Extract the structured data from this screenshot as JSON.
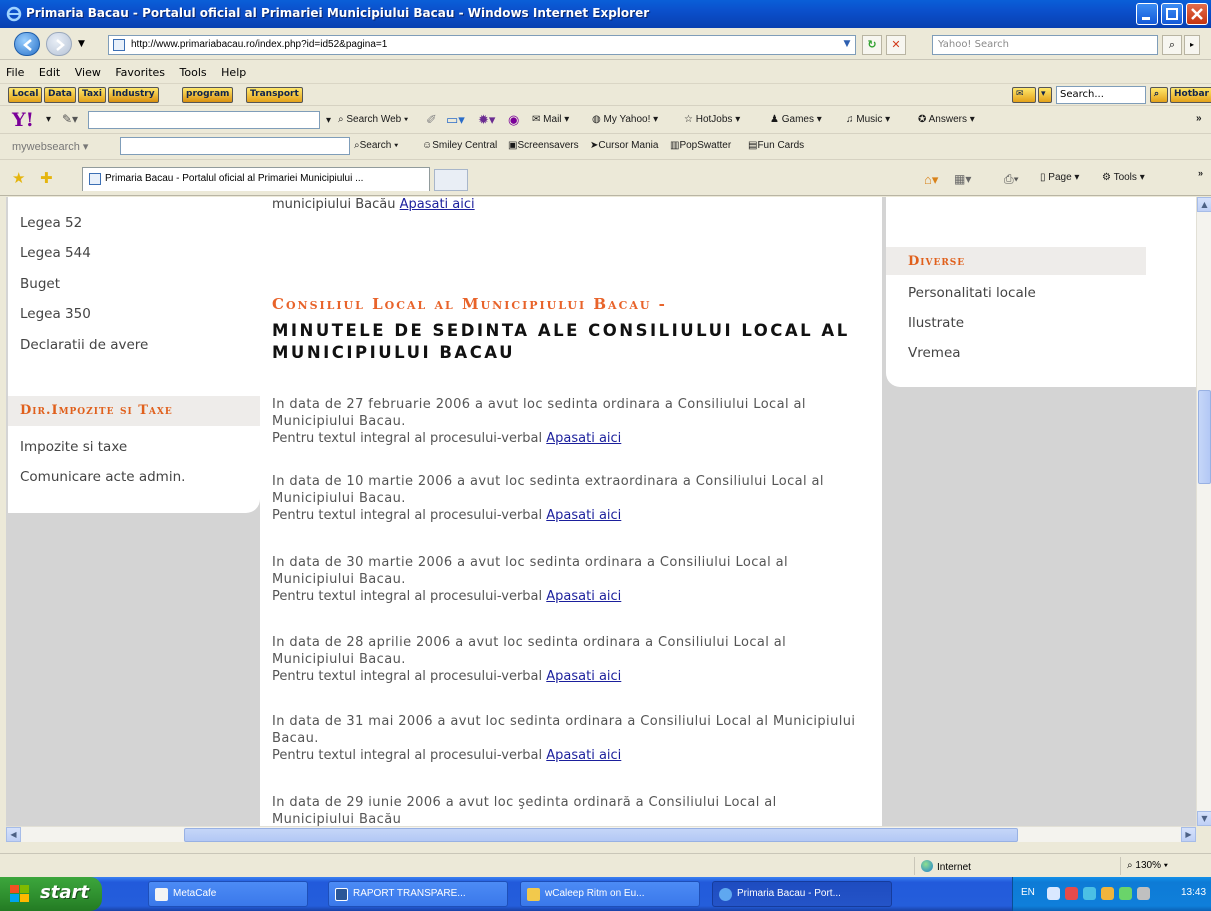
{
  "window": {
    "title": "Primaria Bacau - Portalul oficial al Primariei Municipiului Bacau - Windows Internet Explorer"
  },
  "address_bar": {
    "url": "http://www.primariabacau.ro/index.php?id=id52&pagina=1",
    "search_placeholder": "Yahoo! Search"
  },
  "menu": [
    "File",
    "Edit",
    "View",
    "Favorites",
    "Tools",
    "Help"
  ],
  "toolbar1": {
    "chips": [
      "Local",
      "Data",
      "Taxi",
      "Industry",
      "program",
      "Transport"
    ],
    "search_value": "Search...",
    "hotbar": "Hotbar"
  },
  "toolbar2": {
    "search_web": "Search Web",
    "items": [
      "Mail",
      "My Yahoo!",
      "HotJobs",
      "Games",
      "Music",
      "Answers"
    ]
  },
  "toolbar3": {
    "brand": "mywebsearch",
    "search": "Search",
    "items": [
      "Smiley Central",
      "Screensavers",
      "Cursor Mania",
      "PopSwatter",
      "Fun Cards"
    ]
  },
  "tab": {
    "label": "Primaria Bacau - Portalul oficial al Primariei Municipiului ..."
  },
  "cmdbar": {
    "page": "Page",
    "tools": "Tools"
  },
  "left_nav": {
    "items_top": [
      "Legea 52",
      "Legea 544",
      "Buget",
      "Legea 350",
      "Declaratii de avere"
    ],
    "section": "Dir.Impozite si Taxe",
    "items_bottom": [
      "Impozite si taxe",
      "Comunicare acte admin."
    ]
  },
  "main": {
    "top_text": "municipiului Bacău",
    "top_link": "Apasati aici",
    "heading1": "Consiliul Local al Municipiului Bacau -",
    "heading2": "MINUTELE DE SEDINTA ALE CONSILIULUI LOCAL AL MUNICIPIULUI BACAU",
    "entries": [
      {
        "text": "In data de 27 februarie 2006 a avut loc sedinta ordinara a Consiliului Local al Municipiului Bacau.",
        "more": "Pentru textul integral al procesului-verbal",
        "link": "Apasati aici"
      },
      {
        "text": "In data de 10 martie 2006 a avut loc sedinta extraordinara a Consiliului Local al Municipiului Bacau.",
        "more": "Pentru textul integral al procesului-verbal",
        "link": "Apasati aici"
      },
      {
        "text": "In data de 30 martie 2006 a avut loc sedinta ordinara a Consiliului Local al Municipiului Bacau.",
        "more": "Pentru textul integral al procesului-verbal",
        "link": "Apasati aici"
      },
      {
        "text": "In data de 28 aprilie 2006 a avut loc sedinta ordinara a Consiliului Local al Municipiului Bacau.",
        "more": "Pentru textul integral al procesului-verbal",
        "link": "Apasati aici"
      },
      {
        "text": "In data de 31 mai 2006 a avut loc sedinta ordinara a Consiliului Local al Municipiului Bacau.",
        "more": "Pentru textul integral al procesului-verbal",
        "link": "Apasati aici"
      },
      {
        "text": "In data de 29 iunie 2006 a avut loc şedinta ordinară a Consiliului Local al Municipiului Bacău",
        "more": "",
        "link": ""
      }
    ]
  },
  "right_nav": {
    "section": "Diverse",
    "items": [
      "Personalitati locale",
      "Ilustrate",
      "Vremea"
    ]
  },
  "status": {
    "zone": "Internet",
    "zoom": "130%"
  },
  "taskbar": {
    "start": "start",
    "items": [
      "MetaCafe",
      "RAPORT TRANSPARE...",
      "wCaleep Ritm on Eu...",
      "Primaria Bacau - Port..."
    ],
    "lang": "EN",
    "clock": "13:43"
  },
  "colors": {
    "accent": "#E0601C",
    "link": "#1B1F9C",
    "titlebar": "#0B4FCB"
  }
}
